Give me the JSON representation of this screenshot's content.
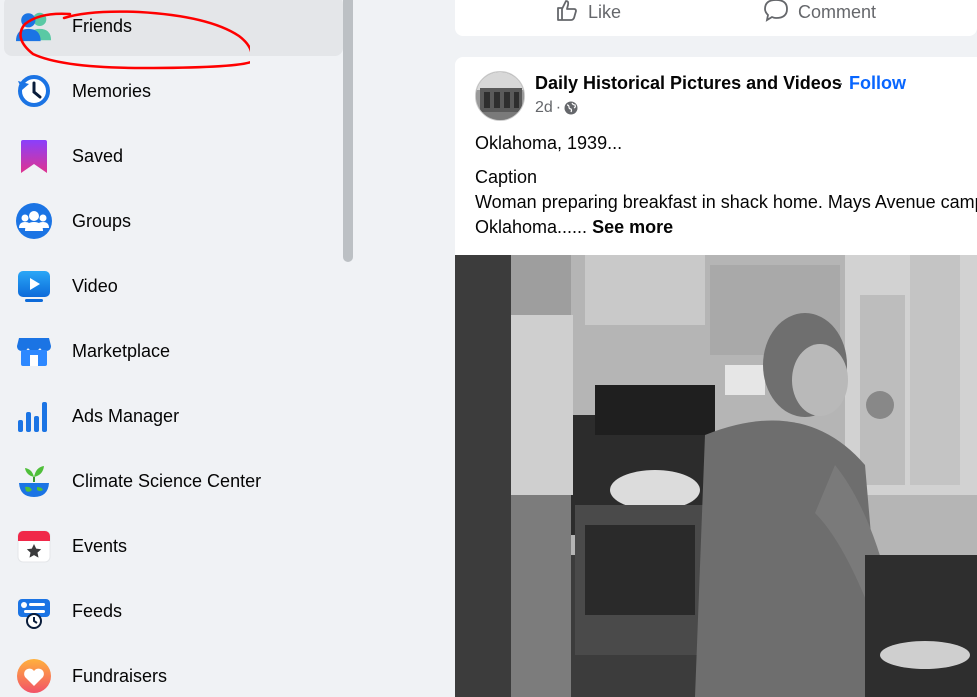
{
  "sidebar": {
    "items": [
      {
        "label": "Friends",
        "icon": "friends-icon"
      },
      {
        "label": "Memories",
        "icon": "memories-icon"
      },
      {
        "label": "Saved",
        "icon": "saved-icon"
      },
      {
        "label": "Groups",
        "icon": "groups-icon"
      },
      {
        "label": "Video",
        "icon": "video-icon"
      },
      {
        "label": "Marketplace",
        "icon": "marketplace-icon"
      },
      {
        "label": "Ads Manager",
        "icon": "ads-manager-icon"
      },
      {
        "label": "Climate Science Center",
        "icon": "climate-science-icon"
      },
      {
        "label": "Events",
        "icon": "events-icon"
      },
      {
        "label": "Feeds",
        "icon": "feeds-icon"
      },
      {
        "label": "Fundraisers",
        "icon": "fundraisers-icon"
      }
    ],
    "annotation_color": "#ff0000"
  },
  "previous_post": {
    "like_label": "Like",
    "comment_label": "Comment"
  },
  "post": {
    "author": "Daily Historical Pictures and Videos",
    "separator": "·",
    "follow_label": "Follow",
    "time": "2d",
    "meta_separator": "·",
    "privacy_icon": "globe-icon",
    "line1": "Oklahoma, 1939...",
    "line2": "Caption",
    "line3": "Woman preparing breakfast in shack home. Mays Avenue camp",
    "line4": "Oklahoma......",
    "see_more": "See more",
    "photo_icon": "historical-photo"
  },
  "colors": {
    "accent": "#0866ff",
    "active_item": "#e4e6e9",
    "background": "#f0f2f5"
  }
}
